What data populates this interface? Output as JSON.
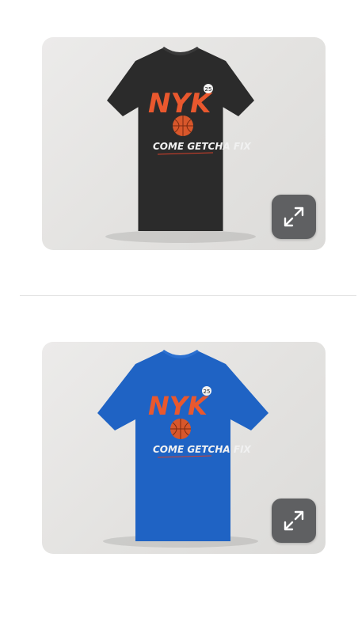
{
  "gallery": {
    "items": [
      {
        "shirt_color": "#2b2b2b",
        "print_title": "NYK",
        "print_badge": "25",
        "print_slogan": "COME GETCHA FIX",
        "expand_icon": "expand-arrows-icon"
      },
      {
        "shirt_color": "#1f63c4",
        "print_title": "NYK",
        "print_badge": "25",
        "print_slogan": "COME GETCHA FIX",
        "expand_icon": "expand-arrows-icon"
      }
    ]
  },
  "colors": {
    "print_orange": "#e9582e",
    "print_red": "#d8402a",
    "expand_button_bg": "#5f6062",
    "card_bg": "#e6e5e3"
  }
}
